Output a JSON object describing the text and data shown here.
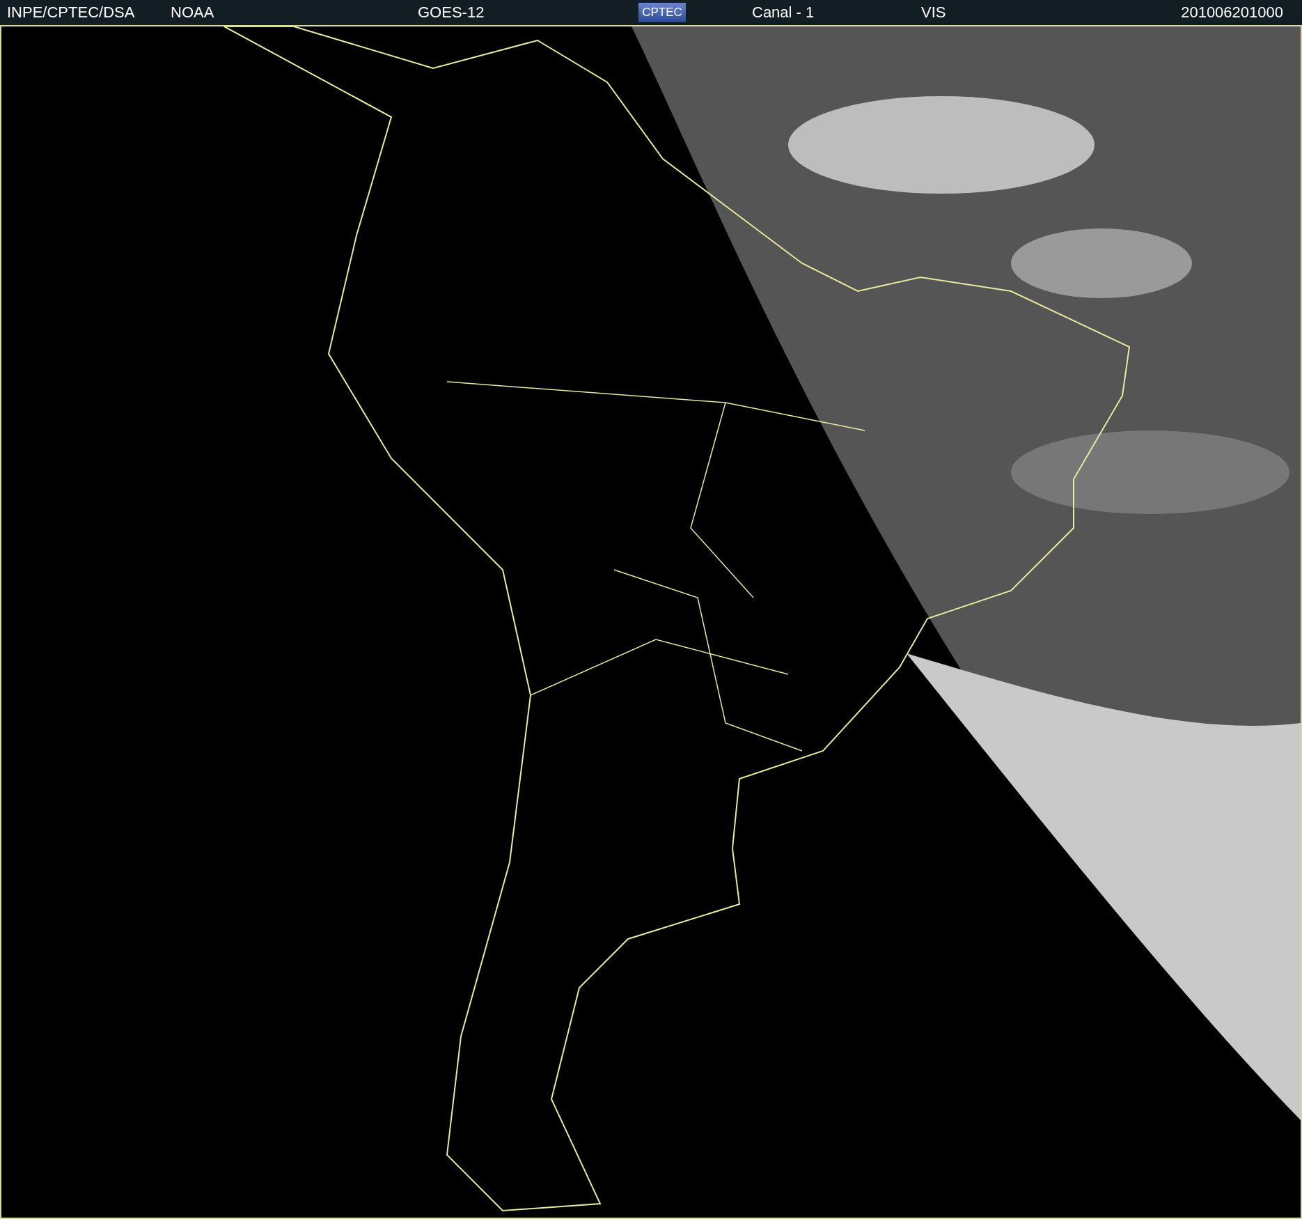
{
  "header": {
    "items": [
      {
        "kind": "text",
        "text": "INPE/CPTEC/DSA"
      },
      {
        "kind": "text",
        "text": "NOAA"
      },
      {
        "kind": "text",
        "text": "GOES-12"
      },
      {
        "kind": "logo",
        "text": "CPTEC"
      },
      {
        "kind": "text",
        "text": "Canal - 1"
      },
      {
        "kind": "text",
        "text": "VIS"
      },
      {
        "kind": "text",
        "text": "201006201000"
      }
    ]
  }
}
